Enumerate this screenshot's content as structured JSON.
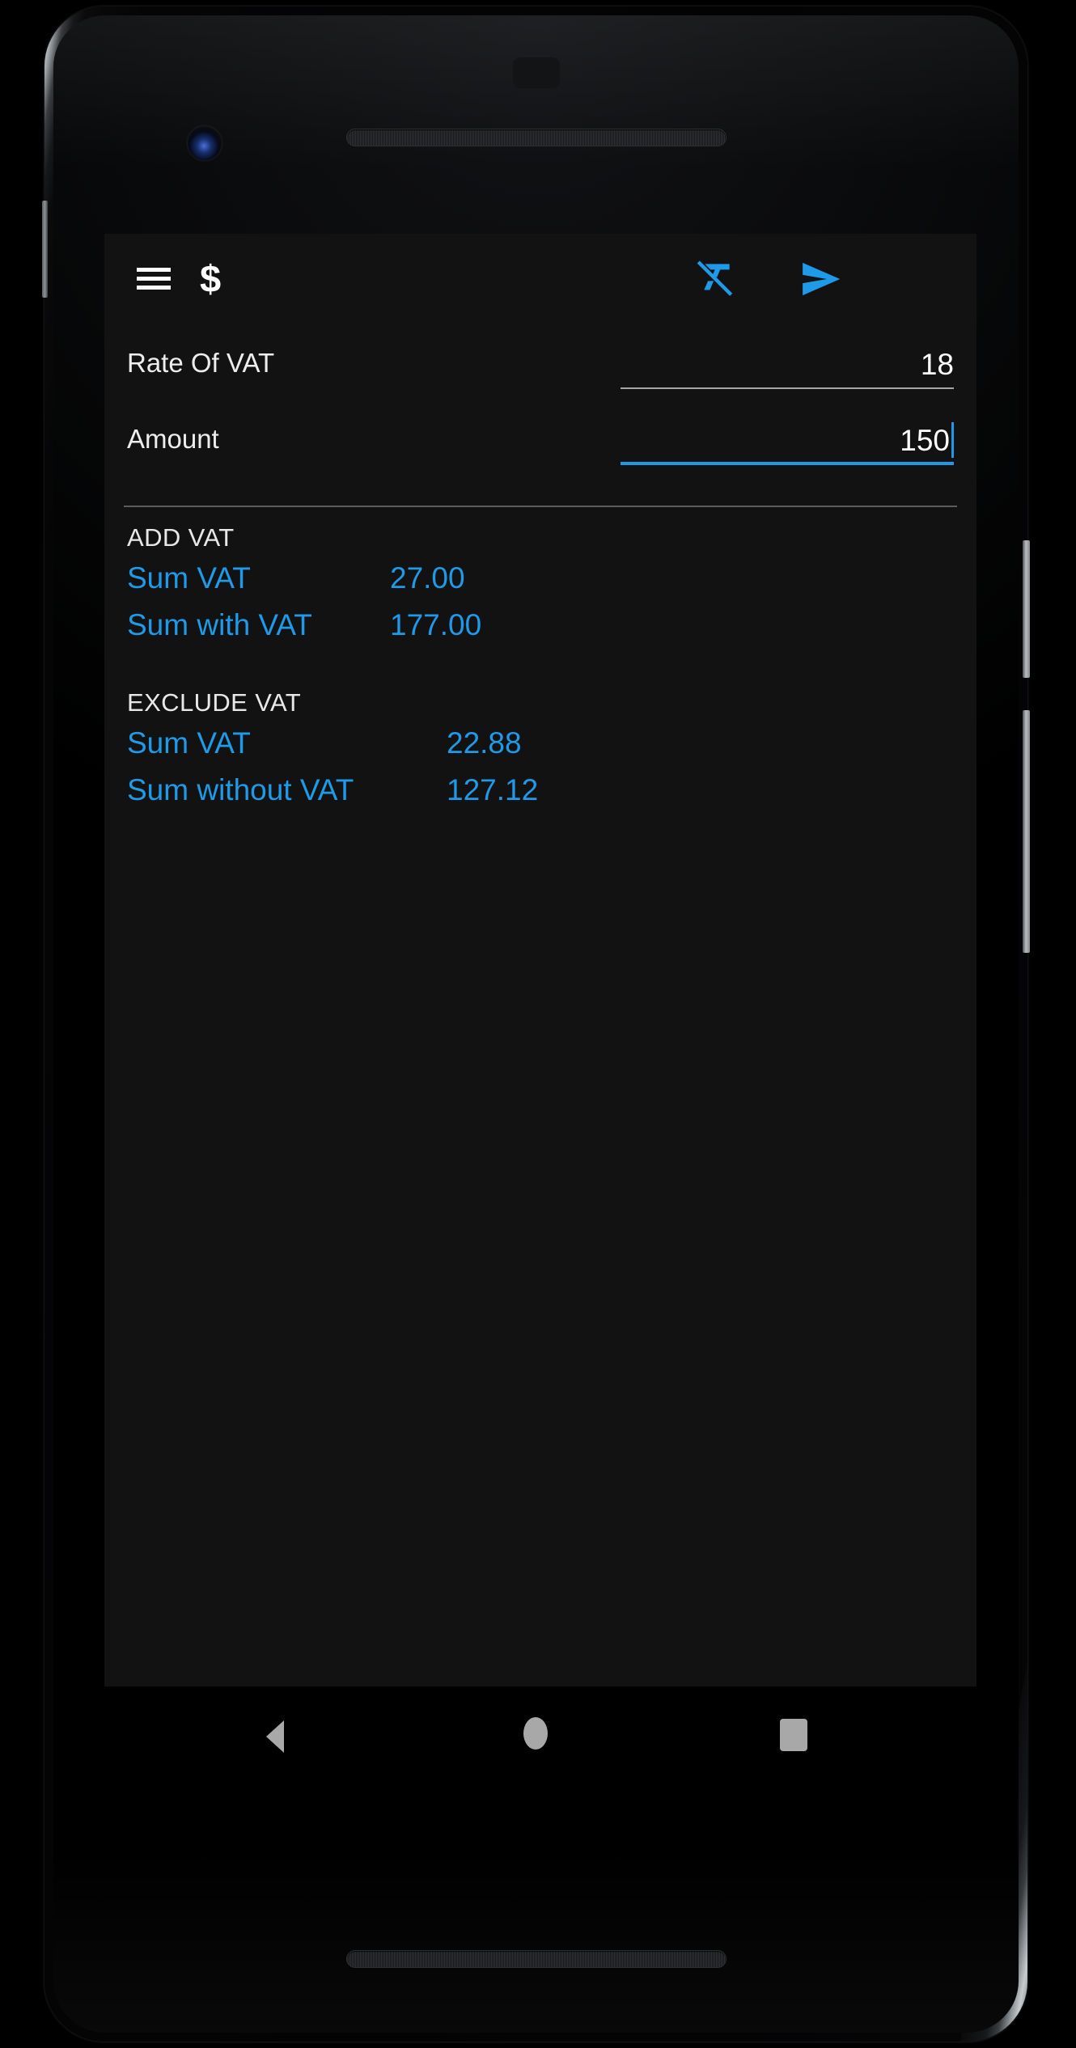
{
  "app": {
    "title": "$",
    "menu_icon": "hamburger-menu-icon",
    "clear_icon": "clear-formatting-icon",
    "send_icon": "send-icon"
  },
  "form": {
    "fields": [
      {
        "label": "Rate Of VAT",
        "value": "18",
        "focused": false
      },
      {
        "label": "Amount",
        "value": "150",
        "focused": true
      }
    ]
  },
  "results": {
    "add_vat": {
      "title": "ADD VAT",
      "rows": [
        {
          "label": "Sum VAT",
          "value": "27.00"
        },
        {
          "label": "Sum with VAT",
          "value": "177.00"
        }
      ]
    },
    "exclude_vat": {
      "title": "EXCLUDE VAT",
      "rows": [
        {
          "label": "Sum VAT",
          "value": "22.88"
        },
        {
          "label": "Sum without VAT",
          "value": "127.12"
        }
      ]
    }
  },
  "navbar": {
    "back": "back-triangle-icon",
    "home": "home-circle-icon",
    "recents": "recents-square-icon"
  },
  "colors": {
    "accent": "#1e9ae8",
    "background": "#121212",
    "text": "#ffffff",
    "divider": "#5c5c5c"
  }
}
